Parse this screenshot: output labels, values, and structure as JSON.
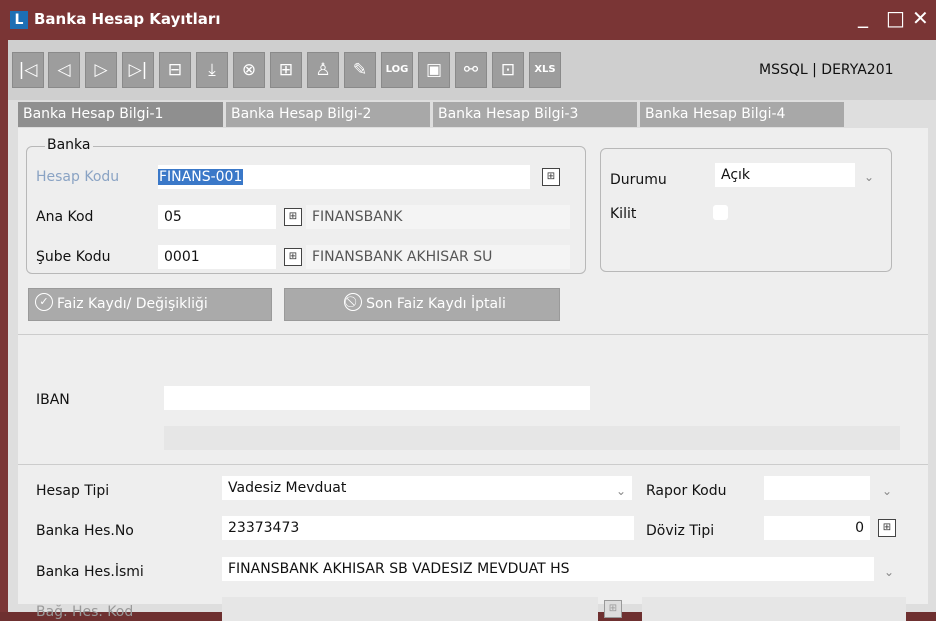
{
  "window": {
    "title": "Banka Hesap Kayıtları",
    "minimize": "_",
    "maximize": "□",
    "close": "✕"
  },
  "toolbar": {
    "buttons": [
      {
        "name": "first-record-icon",
        "glyph": "|◁"
      },
      {
        "name": "previous-record-icon",
        "glyph": "◁"
      },
      {
        "name": "next-record-icon",
        "glyph": "▷"
      },
      {
        "name": "last-record-icon",
        "glyph": "▷|"
      },
      {
        "name": "new-record-icon",
        "glyph": "⊟"
      },
      {
        "name": "save-icon",
        "glyph": "⤓"
      },
      {
        "name": "cancel-icon",
        "glyph": "⊗"
      },
      {
        "name": "copy-record-icon",
        "glyph": "⊞"
      },
      {
        "name": "user-icon",
        "glyph": "♙"
      },
      {
        "name": "edit-icon",
        "glyph": "✎"
      },
      {
        "name": "log-icon",
        "glyph": "LOG"
      },
      {
        "name": "print-icon",
        "glyph": "▣"
      },
      {
        "name": "link-icon",
        "glyph": "⚯"
      },
      {
        "name": "lock-icon",
        "glyph": "⊡"
      },
      {
        "name": "excel-icon",
        "glyph": "XLS"
      }
    ],
    "server": "MSSQL | DERYA201"
  },
  "tabs": [
    "Banka Hesap Bilgi-1",
    "Banka Hesap Bilgi-2",
    "Banka Hesap Bilgi-3",
    "Banka Hesap Bilgi-4"
  ],
  "banka": {
    "legend": "Banka",
    "hesap_kodu_label": "Hesap Kodu",
    "hesap_kodu": "FINANS-001",
    "ana_kod_label": "Ana Kod",
    "ana_kod": "05",
    "ana_kod_name": "FINANSBANK",
    "sube_kodu_label": "Şube Kodu",
    "sube_kodu": "0001",
    "sube_name": "FINANSBANK AKHISAR SU"
  },
  "status": {
    "durumu_label": "Durumu",
    "durumu": "Açık",
    "kilit_label": "Kilit",
    "kilit": false
  },
  "actions": {
    "faiz": "Faiz Kaydı/ Değişikliği",
    "iptal": "Son Faiz Kaydı İptali"
  },
  "iban": {
    "label": "IBAN",
    "value": "",
    "value2": ""
  },
  "hesap": {
    "tipi_label": "Hesap Tipi",
    "tipi": "Vadesiz Mevduat",
    "rapor_label": "Rapor Kodu",
    "rapor": "",
    "hesno_label": "Banka Hes.No",
    "hesno": "23373473",
    "doviz_label": "Döviz Tipi",
    "doviz": "0",
    "isim_label": "Banka Hes.İsmi",
    "isim": "FINANSBANK AKHISAR SB VADESIZ MEVDUAT HS",
    "bag_label": "Bağ. Hes. Kod",
    "bag": "",
    "bag_name": ""
  },
  "colors": {
    "titlebar": "#7a3535",
    "button": "#9d9d9d",
    "panel": "#eeeeee"
  }
}
